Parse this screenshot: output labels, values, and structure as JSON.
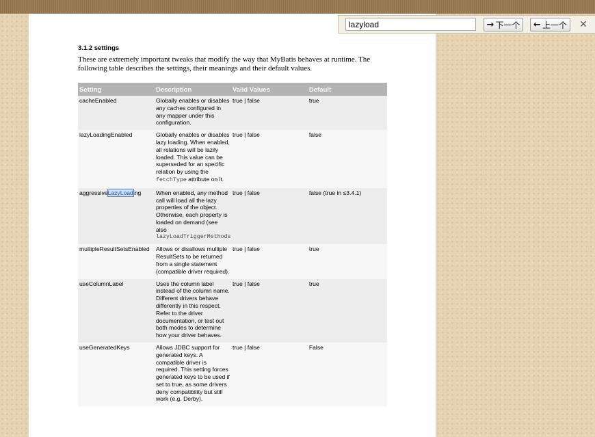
{
  "section": {
    "title": "3.1.2 settings",
    "intro": "These are extremely important tweaks that modify the way that MyBatis behaves at runtime. The following table describes the settings, their meanings and their default values."
  },
  "table": {
    "headers": [
      "Setting",
      "Description",
      "Valid Values",
      "Default"
    ],
    "rows": [
      {
        "setting": "cacheEnabled",
        "description": "Globally enables or disables any caches configured in any mapper under this configuration.",
        "valid": "true | false",
        "default": "true"
      },
      {
        "setting": "lazyLoadingEnabled",
        "description_pre": "Globally enables or disables lazy loading. When enabled, all relations will be lazily loaded. This value can be superseded for an specific relation by using the ",
        "description_code": "fetchType",
        "description_post": " attribute on it.",
        "valid": "true | false",
        "default": "false"
      },
      {
        "setting_pre": "aggressive",
        "setting_match": "LazyLoad",
        "setting_post": "ing",
        "description": "When enabled, any method call will load all the lazy properties of the object. Otherwise, each property is loaded on demand (see also",
        "description_code": "lazyLoadTriggerMethods",
        "valid": "true | false",
        "default": "false (true in ≤3.4.1)"
      },
      {
        "setting": "multipleResultSetsEnabled",
        "description": "Allows or disallows multiple ResultSets to be returned from a single statement (compatible driver required).",
        "valid": "true | false",
        "default": "true"
      },
      {
        "setting": "useColumnLabel",
        "description": "Uses the column label instead of the column name. Different drivers behave differently in this respect. Refer to the driver documentation, or test out both modes to determine how your driver behaves.",
        "valid": "true | false",
        "default": "true"
      },
      {
        "setting": "useGeneratedKeys",
        "description": "Allows JDBC support for generated keys. A compatible driver is required. This setting forces generated keys to be used if set to true, as some drivers deny compatibility but still work (e.g. Derby).",
        "valid": "true | false",
        "default": "False"
      }
    ]
  },
  "findbar": {
    "query": "lazyload",
    "next_label": "下一个",
    "prev_label": "上一个",
    "close_label": "✕",
    "next_icon": "→",
    "prev_icon": "←"
  }
}
